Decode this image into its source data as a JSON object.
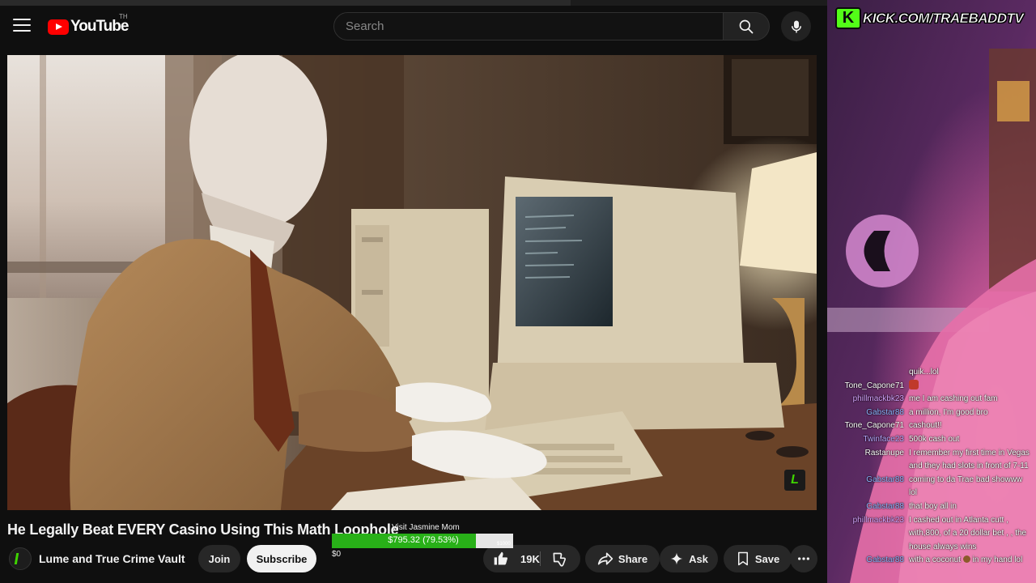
{
  "youtube": {
    "logo_text": "YouTube",
    "country_code": "TH",
    "search": {
      "placeholder": "Search"
    },
    "video": {
      "title": "He Legally Beat EVERY Casino Using This Math Loophole",
      "channel": "Lume and True Crime Vault",
      "join_label": "Join",
      "subscribe_label": "Subscribe",
      "like_count": "19K",
      "share_label": "Share",
      "ask_label": "Ask",
      "save_label": "Save"
    },
    "icons": [
      "menu-icon",
      "youtube-logo-icon",
      "search-icon",
      "mic-icon",
      "like-icon",
      "dislike-icon",
      "share-icon",
      "ask-sparkle-icon",
      "save-icon",
      "more-icon"
    ]
  },
  "donation_widget": {
    "label": "Visit Jasmine Mom",
    "amount_text": "$795.32 (79.53%)",
    "progress_fraction": 0.7953,
    "goal_text": "$1000",
    "start_text": "$0",
    "fill_color": "#28b018"
  },
  "kick": {
    "banner_letter": "K",
    "banner_text": "KICK.COM/TRAEBADDTV",
    "brand_color": "#53fc18",
    "chat": [
      {
        "user": "",
        "text": "quik...lol",
        "user_class": "u-tone"
      },
      {
        "user": "Tone_Capone71",
        "text": "",
        "emote": true,
        "user_class": "u-tone"
      },
      {
        "user": "phillmackbk23",
        "text": "me I am cashing out fam",
        "user_class": "u-phill"
      },
      {
        "user": "Gabstar88",
        "text": "a million, I'm good bro",
        "user_class": "u-gab"
      },
      {
        "user": "Tone_Capone71",
        "text": "cashout!!",
        "user_class": "u-tone"
      },
      {
        "user": "Twinface23",
        "text": "500k cash out",
        "user_class": "u-twin"
      },
      {
        "user": "Rastanupe",
        "text": "I remember my first time in Vegas and they had slots in front of 7-11",
        "user_class": "u-rast"
      },
      {
        "user": "Gabstar88",
        "text": "coming to da Trae bad showww lol",
        "user_class": "u-gab"
      },
      {
        "user": "Gabstar88",
        "text": "that boy all in",
        "user_class": "u-gab"
      },
      {
        "user": "phillmackbk23",
        "text": "I cashed out in Atlanta cutt , with,800, of a 20 dollar bet , , the house always wins",
        "user_class": "u-phill"
      },
      {
        "user": "Gabstar88",
        "text": "with a coconut",
        "text_after": "in my hand lol",
        "nut": true,
        "user_class": "u-gab"
      }
    ]
  }
}
